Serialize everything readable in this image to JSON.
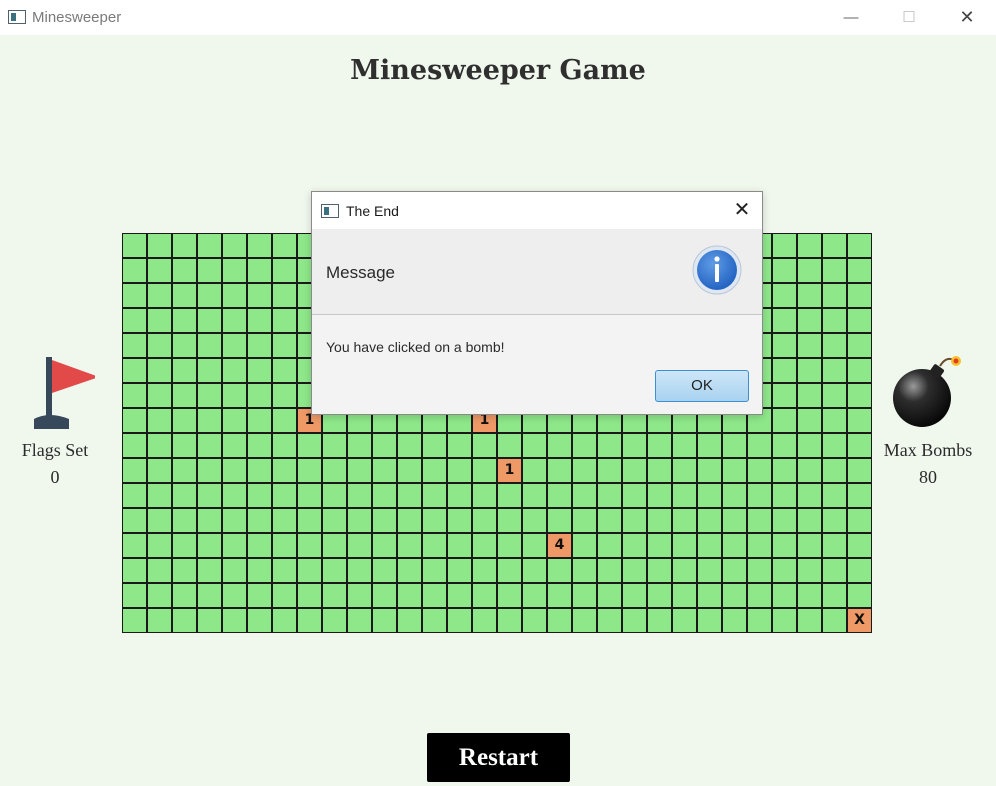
{
  "window": {
    "title": "Minesweeper",
    "controls": {
      "minimize": "—",
      "maximize": "☐",
      "close": "✕"
    }
  },
  "game": {
    "title": "Minesweeper Game",
    "flags_label": "Flags Set",
    "flags_value": "0",
    "bombs_label": "Max Bombs",
    "bombs_value": "80",
    "restart_label": "Restart"
  },
  "board": {
    "rows": 16,
    "cols": 30,
    "revealed": [
      {
        "row": 7,
        "col": 7,
        "text": "1"
      },
      {
        "row": 7,
        "col": 14,
        "text": "1"
      },
      {
        "row": 9,
        "col": 15,
        "text": "1"
      },
      {
        "row": 12,
        "col": 17,
        "text": "4"
      },
      {
        "row": 15,
        "col": 29,
        "text": "X"
      }
    ]
  },
  "dialog": {
    "title": "The End",
    "heading": "Message",
    "message": "You have clicked on a bomb!",
    "ok_label": "OK",
    "close_glyph": "✕"
  },
  "colors": {
    "cell": "#8ee88a",
    "revealed_cell": "#ee9966",
    "background": "#f0f8ee"
  }
}
